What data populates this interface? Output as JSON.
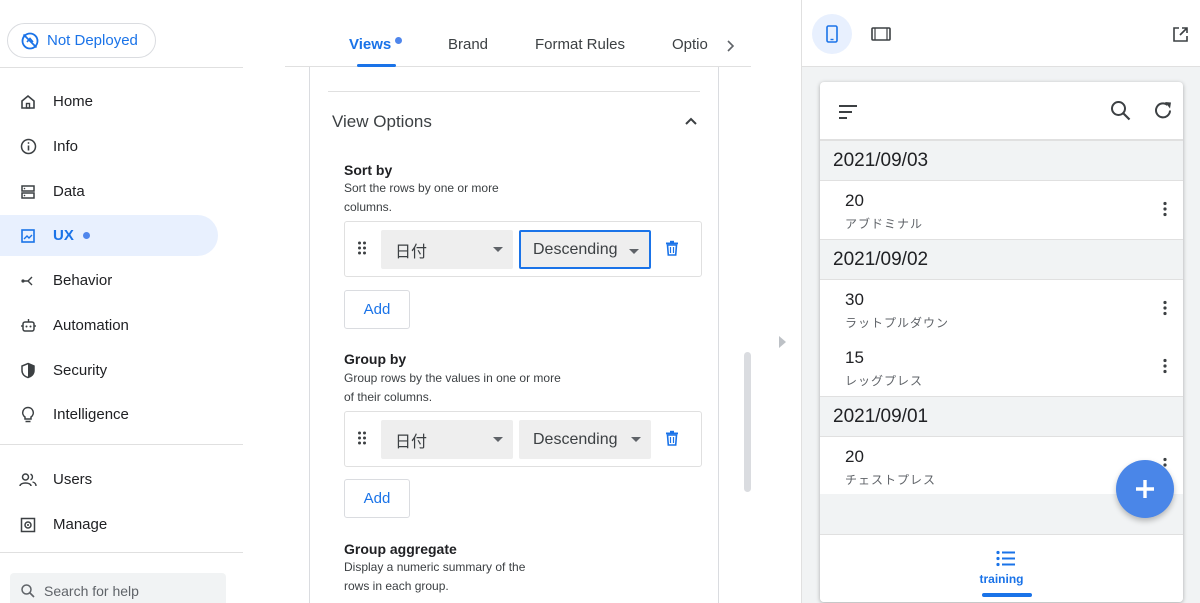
{
  "deploy_status": {
    "label": "Not Deployed"
  },
  "sidebar": {
    "items": [
      {
        "label": "Home",
        "icon": "home-icon"
      },
      {
        "label": "Info",
        "icon": "info-icon"
      },
      {
        "label": "Data",
        "icon": "data-icon"
      },
      {
        "label": "UX",
        "icon": "ux-icon",
        "active": true,
        "has_dot": true
      },
      {
        "label": "Behavior",
        "icon": "behavior-icon"
      },
      {
        "label": "Automation",
        "icon": "automation-icon"
      },
      {
        "label": "Security",
        "icon": "shield-icon"
      },
      {
        "label": "Intelligence",
        "icon": "lightbulb-icon"
      },
      {
        "label": "Users",
        "icon": "users-icon"
      },
      {
        "label": "Manage",
        "icon": "manage-icon"
      }
    ],
    "help_search_placeholder": "Search for help"
  },
  "tabs": {
    "items": [
      {
        "label": "Views",
        "active": true
      },
      {
        "label": "Brand"
      },
      {
        "label": "Format Rules"
      },
      {
        "label": "Optio"
      }
    ]
  },
  "view_options": {
    "title": "View Options",
    "sort_by": {
      "label": "Sort by",
      "desc": "Sort the rows by one or more columns.",
      "column": "日付",
      "order": "Descending",
      "add_label": "Add"
    },
    "group_by": {
      "label": "Group by",
      "desc": "Group rows by the values in one or more of their columns.",
      "column": "日付",
      "order": "Descending",
      "add_label": "Add"
    },
    "group_aggregate": {
      "label": "Group aggregate",
      "desc": "Display a numeric summary of the rows in each group."
    }
  },
  "preview": {
    "groups": [
      {
        "date": "2021/09/03",
        "rows": [
          {
            "value": "20",
            "name": "アブドミナル"
          }
        ]
      },
      {
        "date": "2021/09/02",
        "rows": [
          {
            "value": "30",
            "name": "ラットプルダウン"
          },
          {
            "value": "15",
            "name": "レッグプレス"
          }
        ]
      },
      {
        "date": "2021/09/01",
        "rows": [
          {
            "value": "20",
            "name": "チェストプレス"
          }
        ]
      }
    ],
    "bottom_nav_label": "training"
  },
  "colors": {
    "accent": "#1a73e8",
    "fab": "#4a86e8",
    "active_bg": "#e8f0fe"
  }
}
